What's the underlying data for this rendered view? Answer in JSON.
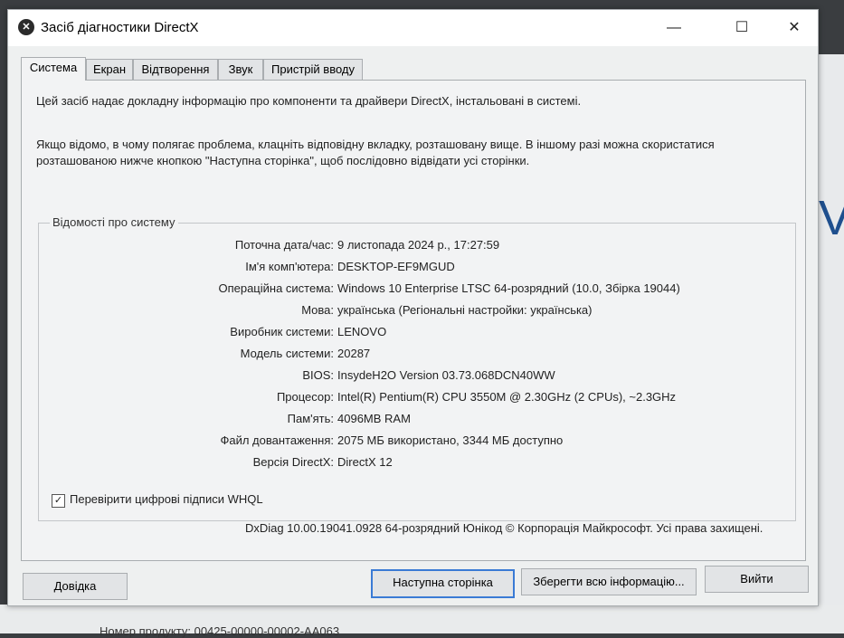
{
  "window": {
    "title": "Засіб діагностики DirectX",
    "minimize": "—",
    "maximize": "☐",
    "close": "✕"
  },
  "tabs": [
    {
      "label": "Система",
      "active": true
    },
    {
      "label": "Екран",
      "active": false
    },
    {
      "label": "Відтворення",
      "active": false
    },
    {
      "label": "Звук",
      "active": false
    },
    {
      "label": "Пристрій вводу",
      "active": false
    }
  ],
  "intro": {
    "line1": "Цей засіб надає докладну інформацію про компоненти та драйвери DirectX, інстальовані в системі.",
    "line2": "Якщо відомо, в чому полягає проблема, клацніть відповідну вкладку, розташовану вище.  В іншому разі можна скористатися",
    "line3": "розташованою нижче кнопкою \"Наступна сторінка\", щоб послідовно відвідати усі сторінки."
  },
  "system_info": {
    "group_title": "Відомості про систему",
    "rows": [
      {
        "label": "Поточна дата/час:",
        "value": "9 листопада 2024 р., 17:27:59"
      },
      {
        "label": "Ім'я комп'ютера:",
        "value": "DESKTOP-EF9MGUD"
      },
      {
        "label": "Операційна система:",
        "value": "Windows 10 Enterprise LTSC 64-розрядний (10.0, Збірка 19044)"
      },
      {
        "label": "Мова:",
        "value": "українська (Регіональні настройки: українська)"
      },
      {
        "label": "Виробник системи:",
        "value": "LENOVO"
      },
      {
        "label": "Модель системи:",
        "value": "20287"
      },
      {
        "label": "BIOS:",
        "value": "InsydeH2O Version 03.73.068DCN40WW"
      },
      {
        "label": "Процесор:",
        "value": "Intel(R) Pentium(R) CPU 3550M @ 2.30GHz (2 CPUs), ~2.3GHz"
      },
      {
        "label": "Пам'ять:",
        "value": "4096MB RAM"
      },
      {
        "label": "Файл довантаження:",
        "value": "2075 МБ використано, 3344 МБ доступно"
      },
      {
        "label": "Версія DirectX:",
        "value": "DirectX 12"
      }
    ],
    "whql_checkbox": {
      "label": "Перевірити цифрові підписи WHQL",
      "checked": true,
      "mark": "✓"
    }
  },
  "footer": {
    "copyright": "DxDiag 10.00.19041.0928 64-розрядний Юнікод  © Корпорація Майкрософт. Усі права захищені."
  },
  "buttons": {
    "help": "Довідка",
    "next_page": "Наступна сторінка",
    "save_all": "Зберегти всю інформацію...",
    "exit": "Вийти"
  },
  "background": {
    "big_letter": "V",
    "bottom_text": "Номер продукту: 00425-00000-00002-AA063"
  },
  "colors": {
    "accent": "#3a7bd5",
    "titlebar": "#ffffff",
    "panel": "#f2f3f4"
  }
}
